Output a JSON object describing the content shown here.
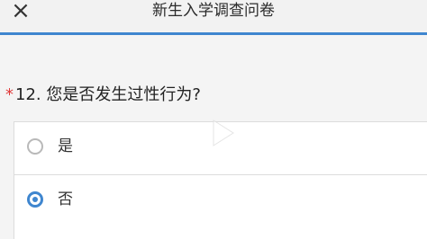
{
  "header": {
    "close_icon": "close-icon",
    "title": "新生入学调查问卷"
  },
  "question": {
    "required_mark": "*",
    "text": "12. 您是否发生过性行为?"
  },
  "options": [
    {
      "label": "是",
      "selected": false
    },
    {
      "label": "否",
      "selected": true
    }
  ],
  "colors": {
    "accent": "#3f86cf",
    "required": "#e03a3a",
    "background": "#f4f4f4"
  }
}
